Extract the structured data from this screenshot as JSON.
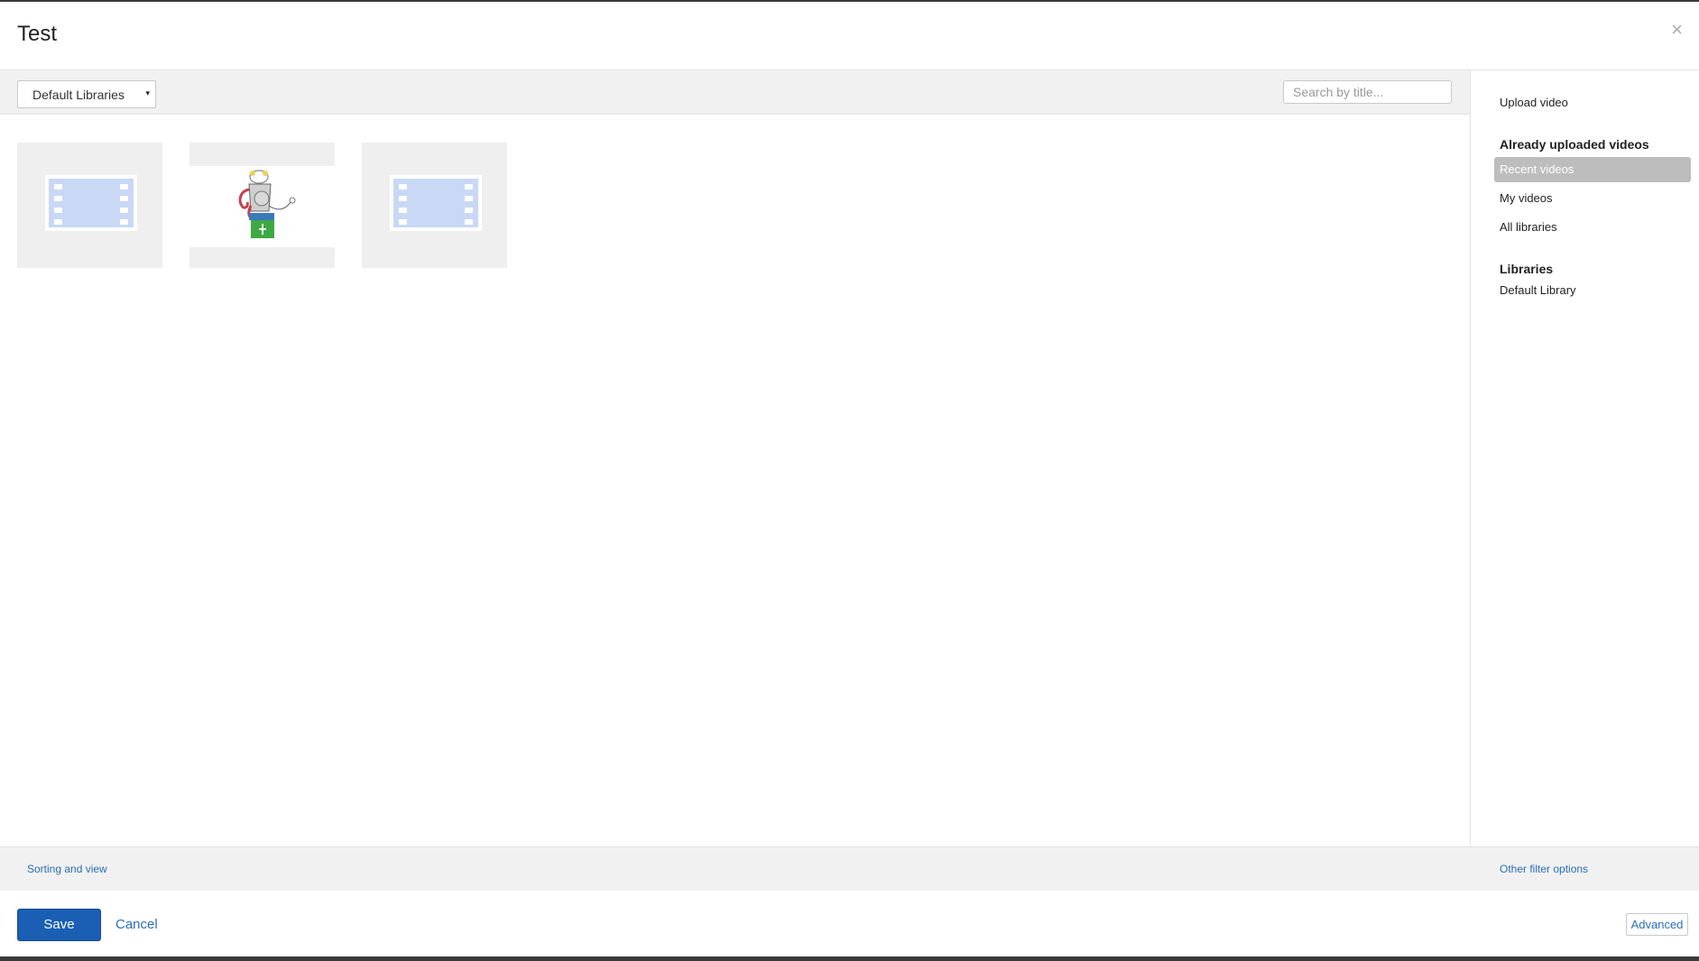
{
  "dialog": {
    "title": "Test",
    "close_glyph": "×"
  },
  "toolbar": {
    "library_select": {
      "selected": "Default Libraries",
      "caret": "▾"
    },
    "search": {
      "placeholder": "Search by title...",
      "value": ""
    }
  },
  "videos": [
    {
      "kind": "film-placeholder",
      "icon": "film-icon"
    },
    {
      "kind": "artwork",
      "icon": "robot-chef-artwork"
    },
    {
      "kind": "film-placeholder",
      "icon": "film-icon"
    }
  ],
  "sidebar": {
    "upload_label": "Upload video",
    "already_uploaded_heading": "Already uploaded videos",
    "items": [
      {
        "label": "Recent videos",
        "active": true
      },
      {
        "label": "My videos",
        "active": false
      },
      {
        "label": "All libraries",
        "active": false
      }
    ],
    "libraries_heading": "Libraries",
    "libraries": [
      {
        "label": "Default Library"
      }
    ]
  },
  "filter_bar": {
    "sorting_label": "Sorting and view",
    "other_filters_label": "Other filter options"
  },
  "actions": {
    "save_label": "Save",
    "cancel_label": "Cancel",
    "advanced_label": "Advanced"
  },
  "colors": {
    "primary": "#1a5fb4",
    "link": "#2a6ebb",
    "active_item": "#bdbdbd",
    "film_fill": "#c9d8f5"
  }
}
